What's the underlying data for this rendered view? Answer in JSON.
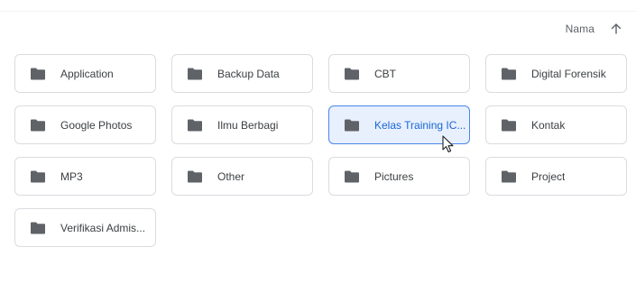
{
  "sort": {
    "label": "Nama",
    "direction_icon": "arrow-up-icon"
  },
  "folders": [
    {
      "name": "Application",
      "icon": "folder-icon",
      "selected": false
    },
    {
      "name": "Backup Data",
      "icon": "folder-icon",
      "selected": false
    },
    {
      "name": "CBT",
      "icon": "folder-icon",
      "selected": false
    },
    {
      "name": "Digital Forensik",
      "icon": "folder-icon",
      "selected": false
    },
    {
      "name": "Google Photos",
      "icon": "folder-icon",
      "selected": false
    },
    {
      "name": "Ilmu Berbagi",
      "icon": "folder-icon",
      "selected": false
    },
    {
      "name": "Kelas Training IC...",
      "icon": "folder-icon",
      "selected": true
    },
    {
      "name": "Kontak",
      "icon": "folder-icon",
      "selected": false
    },
    {
      "name": "MP3",
      "icon": "folder-icon",
      "selected": false
    },
    {
      "name": "Other",
      "icon": "folder-icon",
      "selected": false
    },
    {
      "name": "Pictures",
      "icon": "folder-icon",
      "selected": false
    },
    {
      "name": "Project",
      "icon": "folder-icon",
      "selected": false
    },
    {
      "name": "Verifikasi Admis...",
      "icon": "folder-icon",
      "selected": false
    }
  ],
  "colors": {
    "folder_icon": "#5f6368",
    "selected_bg": "#e8f0fe",
    "selected_border": "#4a86e8",
    "selected_text": "#1967d2"
  }
}
